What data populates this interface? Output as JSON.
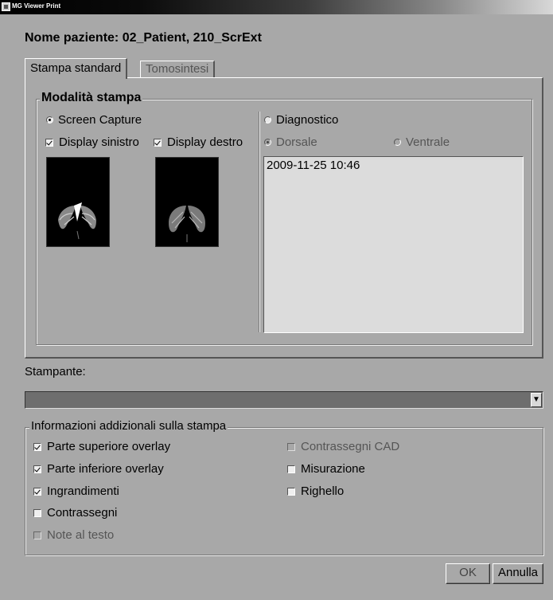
{
  "window": {
    "title": "MG Viewer Print"
  },
  "patient_label": "Nome paziente: 02_Patient, 210_ScrExt",
  "tabs": [
    {
      "label": "Stampa standard",
      "active": true
    },
    {
      "label": "Tomosintesi",
      "active": false
    }
  ],
  "print_mode": {
    "title": "Modalità stampa",
    "screen_capture": {
      "label": "Screen Capture",
      "selected": true
    },
    "display_left": {
      "label": "Display sinistro",
      "checked": true
    },
    "display_right": {
      "label": "Display destro",
      "checked": true
    },
    "diagnostic": {
      "label": "Diagnostico",
      "selected": false
    },
    "dorsal": {
      "label": "Dorsale",
      "selected": true,
      "enabled": false
    },
    "ventral": {
      "label": "Ventrale",
      "selected": false,
      "enabled": false
    },
    "studies": [
      "2009-11-25 10:46"
    ]
  },
  "printer": {
    "label": "Stampante:",
    "selected": ""
  },
  "additional_info": {
    "title": "Informazioni addizionali sulla stampa",
    "options": {
      "top_overlay": {
        "label": "Parte superiore overlay",
        "checked": true,
        "enabled": true
      },
      "bottom_overlay": {
        "label": "Parte inferiore overlay",
        "checked": true,
        "enabled": true
      },
      "magnifications": {
        "label": "Ingrandimenti",
        "checked": true,
        "enabled": true
      },
      "markers": {
        "label": "Contrassegni",
        "checked": false,
        "enabled": true
      },
      "text_notes": {
        "label": "Note al testo",
        "checked": false,
        "enabled": false
      },
      "cad_markers": {
        "label": "Contrassegni CAD",
        "checked": false,
        "enabled": false
      },
      "measurement": {
        "label": "Misurazione",
        "checked": false,
        "enabled": true
      },
      "ruler": {
        "label": "Righello",
        "checked": false,
        "enabled": true
      }
    }
  },
  "buttons": {
    "ok": "OK",
    "cancel": "Annulla"
  },
  "colors": {
    "dialog_bg": "#a8a8a8",
    "listbox_bg": "#dcdcdc",
    "combo_bg": "#6e6e6e"
  }
}
